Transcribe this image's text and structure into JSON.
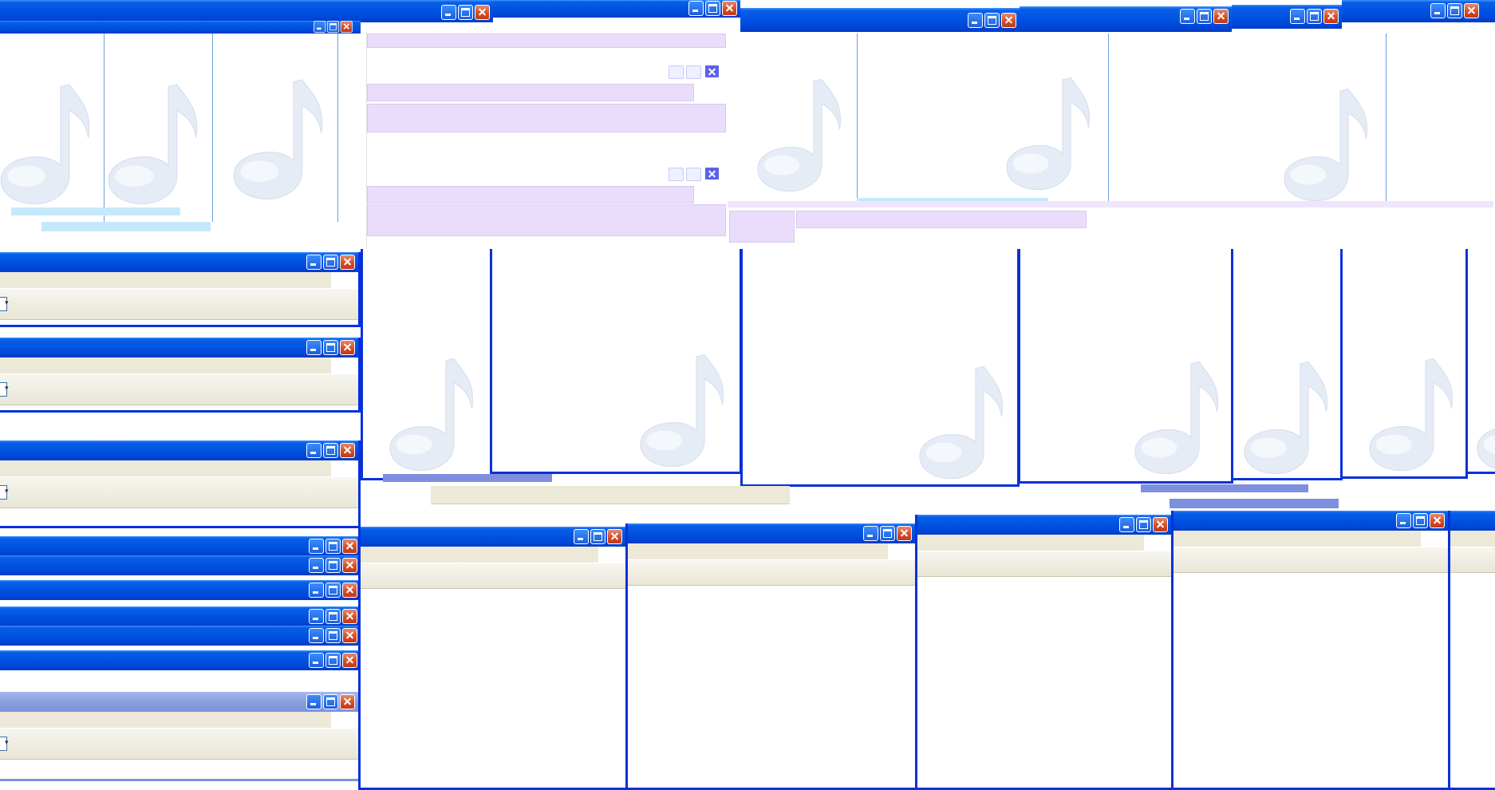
{
  "screen": {
    "description_free": true,
    "window_controls": {
      "minimize": "minimize-icon",
      "maximize": "maximize-icon",
      "close": "close-icon"
    },
    "watermark_icon": "music-note-icon"
  },
  "colors": {
    "titlebar_active": "#0054e3",
    "titlebar_inactive": "#8b9edf",
    "frame": "#0831d9",
    "menubar": "#ece9d8",
    "close_button": "#d24a23",
    "selection_purple": "#e9ddfb",
    "music_note": "#dfe6f3"
  },
  "windows_count_visible": 24
}
